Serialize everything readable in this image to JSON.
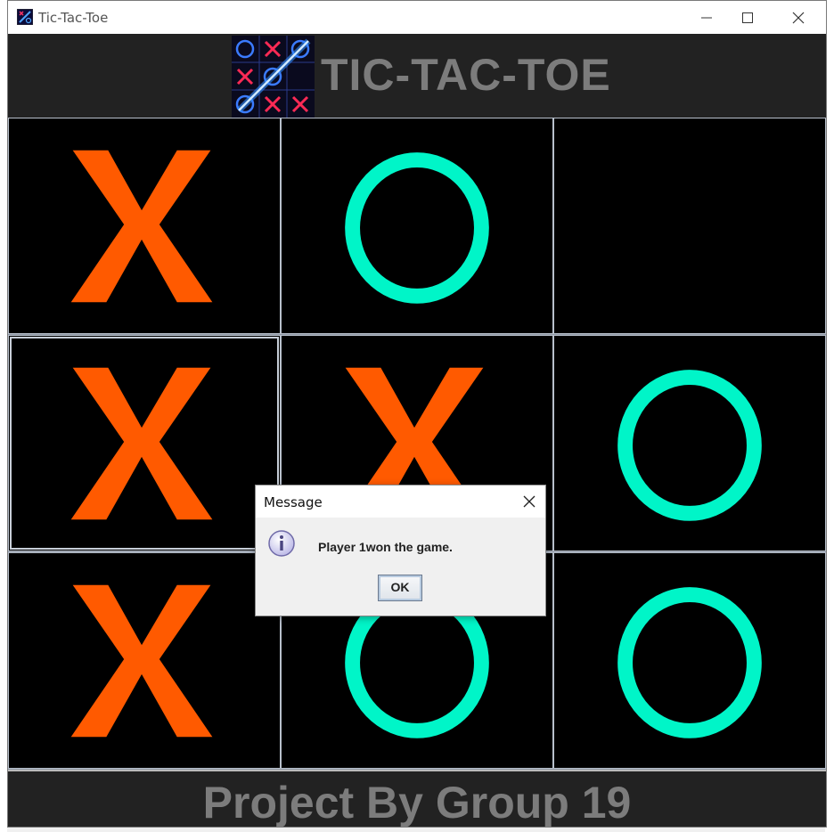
{
  "window": {
    "title": "Tic-Tac-Toe",
    "icon": "tic-tac-toe-app-icon",
    "controls": [
      "minimize-icon",
      "maximize-icon",
      "close-icon"
    ]
  },
  "header": {
    "logo": "tic-tac-toe-logo",
    "title": "TIC-TAC-TOE"
  },
  "board": {
    "cells": [
      [
        "X",
        "O",
        ""
      ],
      [
        "X",
        "X",
        "O"
      ],
      [
        "X",
        "O",
        "O"
      ]
    ],
    "colors": {
      "x": "#ff5a00",
      "o": "#00f5c8",
      "cell_bg": "#000000"
    }
  },
  "footer": {
    "text": "Project By Group 19"
  },
  "dialog": {
    "title": "Message",
    "icon": "info-icon",
    "message": "Player 1won the game.",
    "ok_label": "OK"
  }
}
